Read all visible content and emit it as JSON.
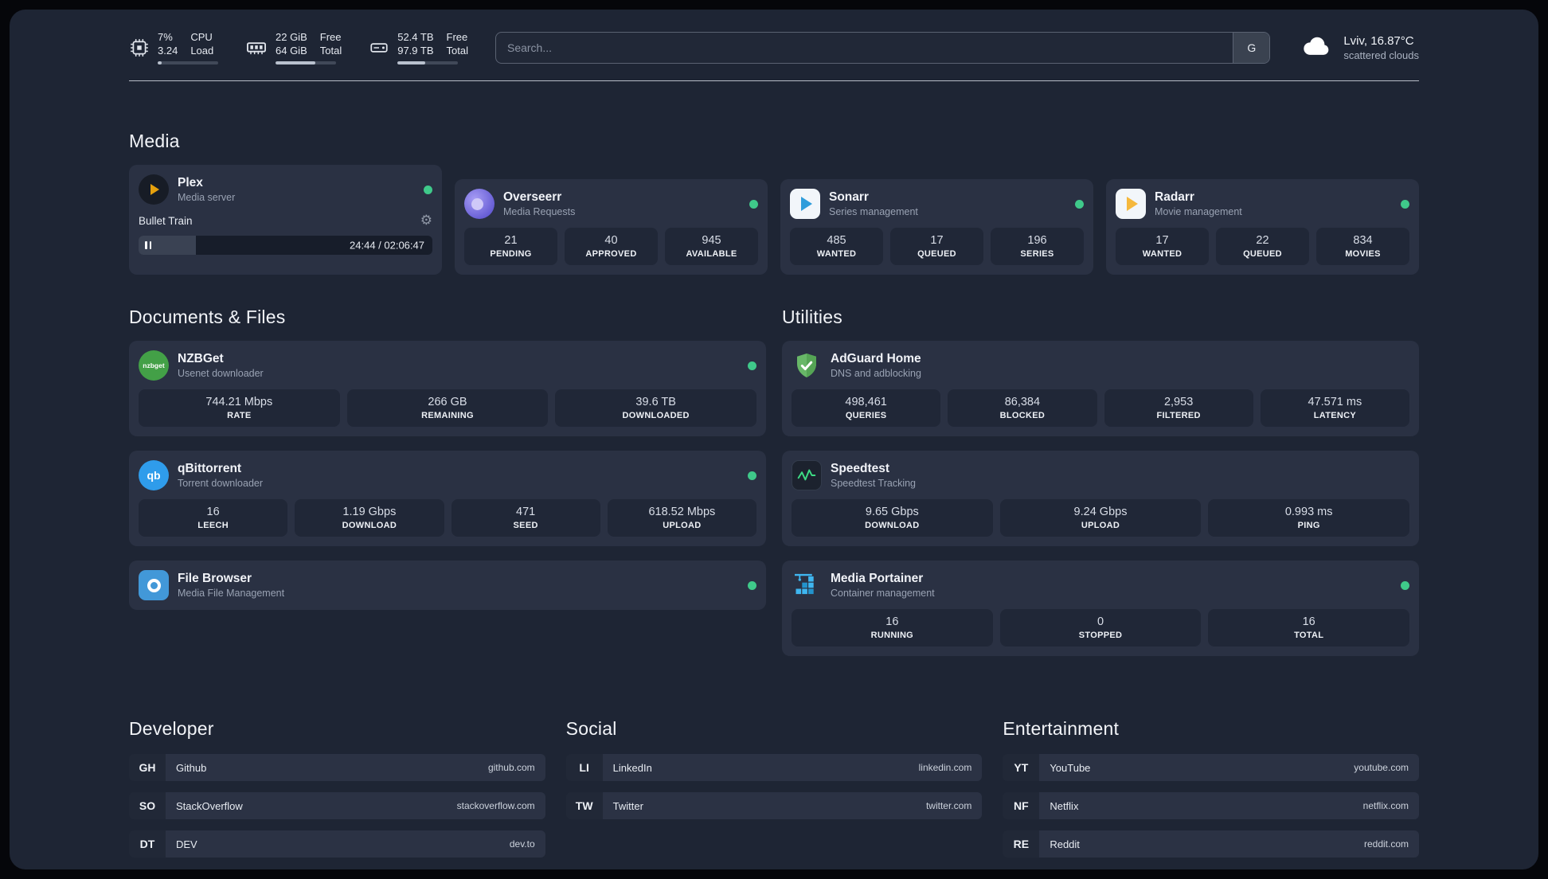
{
  "topbar": {
    "cpu": {
      "value_top": "7%",
      "value_bottom": "3.24",
      "label_top": "CPU",
      "label_bottom": "Load"
    },
    "ram": {
      "value_top": "22 GiB",
      "value_bottom": "64 GiB",
      "label_top": "Free",
      "label_bottom": "Total"
    },
    "disk": {
      "value_top": "52.4 TB",
      "value_bottom": "97.9 TB",
      "label_top": "Free",
      "label_bottom": "Total"
    },
    "search": {
      "placeholder": "Search...",
      "engine_label": "G"
    },
    "weather": {
      "location": "Lviv, 16.87°C",
      "condition": "scattered clouds"
    }
  },
  "media": {
    "title": "Media",
    "plex": {
      "name": "Plex",
      "desc": "Media server",
      "now_playing": "Bullet Train",
      "time": "24:44 / 02:06:47"
    },
    "cards": [
      {
        "name": "Overseerr",
        "desc": "Media Requests",
        "stats": [
          {
            "value": "21",
            "label": "PENDING"
          },
          {
            "value": "40",
            "label": "APPROVED"
          },
          {
            "value": "945",
            "label": "AVAILABLE"
          }
        ]
      },
      {
        "name": "Sonarr",
        "desc": "Series management",
        "stats": [
          {
            "value": "485",
            "label": "WANTED"
          },
          {
            "value": "17",
            "label": "QUEUED"
          },
          {
            "value": "196",
            "label": "SERIES"
          }
        ]
      },
      {
        "name": "Radarr",
        "desc": "Movie management",
        "stats": [
          {
            "value": "17",
            "label": "WANTED"
          },
          {
            "value": "22",
            "label": "QUEUED"
          },
          {
            "value": "834",
            "label": "MOVIES"
          }
        ]
      }
    ]
  },
  "documents": {
    "title": "Documents & Files",
    "cards": [
      {
        "name": "NZBGet",
        "desc": "Usenet downloader",
        "stats": [
          {
            "value": "744.21 Mbps",
            "label": "RATE"
          },
          {
            "value": "266 GB",
            "label": "REMAINING"
          },
          {
            "value": "39.6 TB",
            "label": "DOWNLOADED"
          }
        ]
      },
      {
        "name": "qBittorrent",
        "desc": "Torrent downloader",
        "stats": [
          {
            "value": "16",
            "label": "LEECH"
          },
          {
            "value": "1.19 Gbps",
            "label": "DOWNLOAD"
          },
          {
            "value": "471",
            "label": "SEED"
          },
          {
            "value": "618.52 Mbps",
            "label": "UPLOAD"
          }
        ]
      },
      {
        "name": "File Browser",
        "desc": "Media File Management",
        "stats": []
      }
    ]
  },
  "utilities": {
    "title": "Utilities",
    "cards": [
      {
        "name": "AdGuard Home",
        "desc": "DNS and adblocking",
        "stats": [
          {
            "value": "498,461",
            "label": "QUERIES"
          },
          {
            "value": "86,384",
            "label": "BLOCKED"
          },
          {
            "value": "2,953",
            "label": "FILTERED"
          },
          {
            "value": "47.571 ms",
            "label": "LATENCY"
          }
        ]
      },
      {
        "name": "Speedtest",
        "desc": "Speedtest Tracking",
        "stats": [
          {
            "value": "9.65 Gbps",
            "label": "DOWNLOAD"
          },
          {
            "value": "9.24 Gbps",
            "label": "UPLOAD"
          },
          {
            "value": "0.993 ms",
            "label": "PING"
          }
        ]
      },
      {
        "name": "Media Portainer",
        "desc": "Container management",
        "stats": [
          {
            "value": "16",
            "label": "RUNNING"
          },
          {
            "value": "0",
            "label": "STOPPED"
          },
          {
            "value": "16",
            "label": "TOTAL"
          }
        ]
      }
    ]
  },
  "bookmarks": {
    "developer": {
      "title": "Developer",
      "items": [
        {
          "abbr": "GH",
          "name": "Github",
          "url": "github.com"
        },
        {
          "abbr": "SO",
          "name": "StackOverflow",
          "url": "stackoverflow.com"
        },
        {
          "abbr": "DT",
          "name": "DEV",
          "url": "dev.to"
        }
      ]
    },
    "social": {
      "title": "Social",
      "items": [
        {
          "abbr": "LI",
          "name": "LinkedIn",
          "url": "linkedin.com"
        },
        {
          "abbr": "TW",
          "name": "Twitter",
          "url": "twitter.com"
        }
      ]
    },
    "entertainment": {
      "title": "Entertainment",
      "items": [
        {
          "abbr": "YT",
          "name": "YouTube",
          "url": "youtube.com"
        },
        {
          "abbr": "NF",
          "name": "Netflix",
          "url": "netflix.com"
        },
        {
          "abbr": "RE",
          "name": "Reddit",
          "url": "reddit.com"
        }
      ]
    }
  },
  "icons": {
    "gear": "⚙",
    "nzbget_text": "nzbget",
    "qb_text": "qb"
  },
  "colors": {
    "status_online": "#3fc98a",
    "background": "#1e2534",
    "card": "#2a3143"
  }
}
